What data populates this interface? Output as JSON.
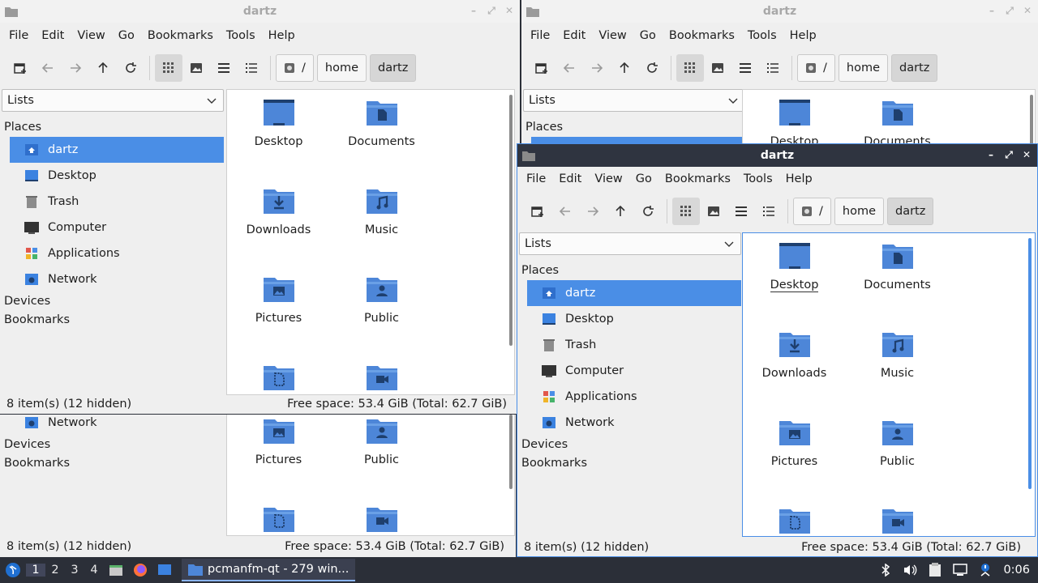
{
  "colors": {
    "accent": "#4a8ee6",
    "folder": "#4d86d8",
    "folder_dark": "#1e3f6e",
    "titlebar_active": "#2f3440",
    "taskbar": "#2b2f38"
  },
  "windows": [
    {
      "id": "w1",
      "title": "dartz",
      "active": false
    },
    {
      "id": "w2",
      "title": "dartz",
      "active": false
    },
    {
      "id": "w3",
      "title": "dartz",
      "active": true
    }
  ],
  "menu": [
    "File",
    "Edit",
    "View",
    "Go",
    "Bookmarks",
    "Tools",
    "Help"
  ],
  "toolbar": {
    "icons": [
      "new-tab-icon",
      "back-icon",
      "forward-icon",
      "up-icon",
      "reload-icon",
      "icon-view-icon",
      "thumbnail-view-icon",
      "compact-view-icon",
      "detailed-list-icon"
    ]
  },
  "path": {
    "root": "/",
    "segments": [
      "home",
      "dartz"
    ]
  },
  "side": {
    "combo": "Lists",
    "places_header": "Places",
    "devices_header": "Devices",
    "bookmarks_header": "Bookmarks",
    "places": [
      {
        "label": "dartz",
        "icon": "home-folder-icon",
        "selected": true
      },
      {
        "label": "Desktop",
        "icon": "desktop-icon"
      },
      {
        "label": "Trash",
        "icon": "trash-icon"
      },
      {
        "label": "Computer",
        "icon": "computer-icon"
      },
      {
        "label": "Applications",
        "icon": "applications-icon"
      },
      {
        "label": "Network",
        "icon": "network-icon"
      }
    ]
  },
  "files": [
    {
      "label": "Desktop",
      "icon": "desktop-folder-icon"
    },
    {
      "label": "Documents",
      "icon": "documents-folder-icon"
    },
    {
      "label": "Downloads",
      "icon": "downloads-folder-icon"
    },
    {
      "label": "Music",
      "icon": "music-folder-icon"
    },
    {
      "label": "Pictures",
      "icon": "pictures-folder-icon"
    },
    {
      "label": "Public",
      "icon": "public-folder-icon"
    },
    {
      "label": "",
      "icon": "templates-folder-icon"
    },
    {
      "label": "",
      "icon": "videos-folder-icon"
    }
  ],
  "status": {
    "items": "8 item(s) (12 hidden)",
    "space": "Free space: 53.4 GiB (Total: 62.7 GiB)"
  },
  "taskbar": {
    "workspaces": [
      "1",
      "2",
      "3",
      "4"
    ],
    "current": "1",
    "task": "pcmanfm-qt - 279 win...",
    "clock": "0:06"
  }
}
